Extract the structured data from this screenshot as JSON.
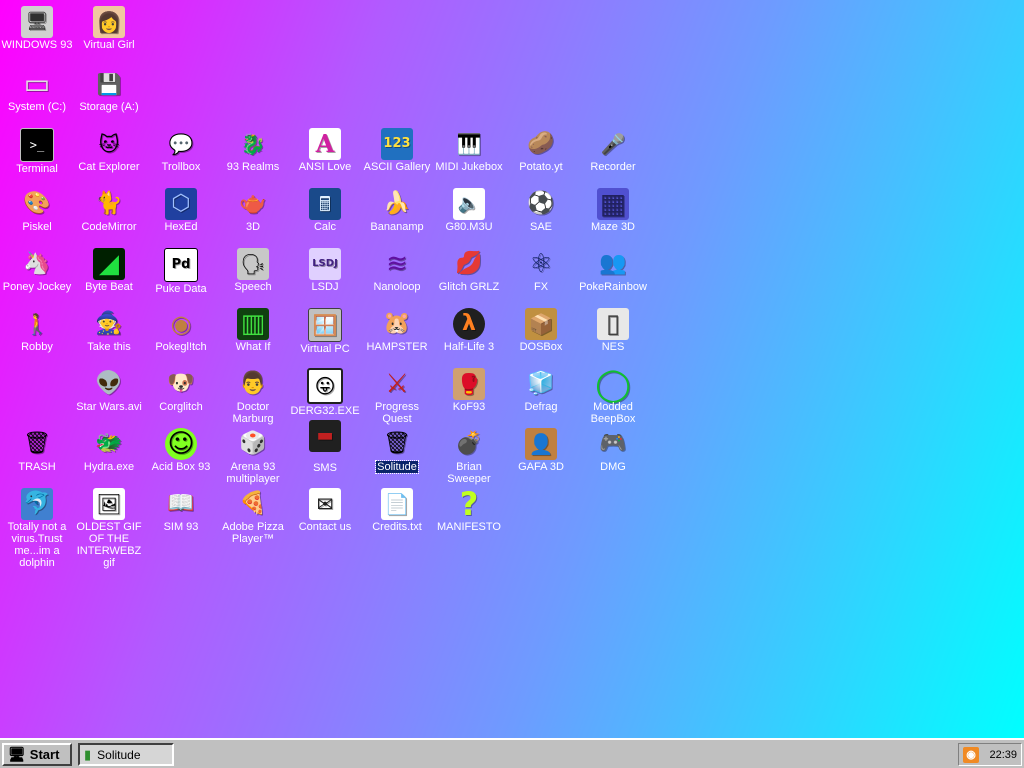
{
  "desktop": {
    "icons": [
      {
        "label": "WINDOWS 93",
        "glyph": "🖥",
        "color": "#d0d0d0"
      },
      {
        "label": "Virtual Girl",
        "glyph": "👩",
        "color": "#f0c8a0"
      },
      {
        "label": "System (C:)",
        "glyph": "▭",
        "color": "#c8c8c8"
      },
      {
        "label": "Storage (A:)",
        "glyph": "💾",
        "color": "#c8c8c8"
      },
      {
        "label": "Terminal",
        "glyph": ">_",
        "color": "#000000"
      },
      {
        "label": "Cat Explorer",
        "glyph": "🐱",
        "color": "#6fb0ff"
      },
      {
        "label": "Trollbox",
        "glyph": "💬",
        "color": "#ffe13a"
      },
      {
        "label": "93 Realms",
        "glyph": "🐉",
        "color": "#ff4040"
      },
      {
        "label": "ANSI Love",
        "glyph": "A",
        "color": "#ff40c0"
      },
      {
        "label": "ASCII Gallery",
        "glyph": "123",
        "color": "#40c8ff"
      },
      {
        "label": "MIDI Jukebox",
        "glyph": "🎹",
        "color": "#ffffff"
      },
      {
        "label": "Potato.yt",
        "glyph": "🥔",
        "color": "#c89040"
      },
      {
        "label": "Recorder",
        "glyph": "🎤",
        "color": "#c0c0c0"
      },
      {
        "label": "Piskel",
        "glyph": "🎨",
        "color": "#f0c050"
      },
      {
        "label": "CodeMirror",
        "glyph": "🐈",
        "color": "#ffffff"
      },
      {
        "label": "HexEd",
        "glyph": "⬡",
        "color": "#2040a0"
      },
      {
        "label": "3D",
        "glyph": "🫖",
        "color": "#e08060"
      },
      {
        "label": "Calc",
        "glyph": "🖩",
        "color": "#2060a0"
      },
      {
        "label": "Bananamp",
        "glyph": "🍌",
        "color": "#ffe030"
      },
      {
        "label": "G80.M3U",
        "glyph": "🔈",
        "color": "#ffffff"
      },
      {
        "label": "SAE",
        "glyph": "⚽",
        "color": "#ff3030"
      },
      {
        "label": "Maze 3D",
        "glyph": "▦",
        "color": "#4040c0"
      },
      {
        "label": "Poney Jockey",
        "glyph": "🦄",
        "color": "#c080ff"
      },
      {
        "label": "Byte Beat",
        "glyph": "◢",
        "color": "#20a020"
      },
      {
        "label": "Puke Data",
        "glyph": "Pd",
        "color": "#ffffff"
      },
      {
        "label": "Speech",
        "glyph": "🗣",
        "color": "#c0c0c0"
      },
      {
        "label": "LSDJ",
        "glyph": "LSDJ",
        "color": "#8040c0"
      },
      {
        "label": "Nanoloop",
        "glyph": "≋",
        "color": "#8020a0"
      },
      {
        "label": "Glitch GRLZ",
        "glyph": "💋",
        "color": "#ff2040"
      },
      {
        "label": "FX",
        "glyph": "⚛",
        "color": "#40a0ff"
      },
      {
        "label": "PokeRainbow",
        "glyph": "👥",
        "color": "#40a040"
      },
      {
        "label": "Robby",
        "glyph": "🚶",
        "color": "#ffffff"
      },
      {
        "label": "Take this",
        "glyph": "🧙",
        "color": "#ff6020"
      },
      {
        "label": "Pokegl!tch",
        "glyph": "◉",
        "color": "#c08040"
      },
      {
        "label": "What If",
        "glyph": "▥",
        "color": "#40a040"
      },
      {
        "label": "Virtual PC",
        "glyph": "🪟",
        "color": "#40a0ff"
      },
      {
        "label": "HAMPSTER",
        "glyph": "🐹",
        "color": "#ffffff"
      },
      {
        "label": "Half-Life 3",
        "glyph": "λ",
        "color": "#ff8020"
      },
      {
        "label": "DOSBox",
        "glyph": "📦",
        "color": "#c09040"
      },
      {
        "label": "NES",
        "glyph": "▯",
        "color": "#e0e0e0"
      },
      {
        "label": "Star Wars.avi",
        "glyph": "👽",
        "color": "#40c040"
      },
      {
        "label": "Corglitch",
        "glyph": "🐶",
        "color": "#f0a040"
      },
      {
        "label": "Doctor Marburg",
        "glyph": "👨",
        "color": "#ff8080"
      },
      {
        "label": "DERG32.EXE",
        "glyph": "😛",
        "color": "#ffffff"
      },
      {
        "label": "Progress Quest",
        "glyph": "⚔",
        "color": "#c02020"
      },
      {
        "label": "KoF93",
        "glyph": "🥊",
        "color": "#c08040"
      },
      {
        "label": "Defrag",
        "glyph": "🧊",
        "color": "#40c0ff"
      },
      {
        "label": "Modded BeepBox",
        "glyph": "◯",
        "color": "#20c040"
      },
      {
        "label": "TRASH",
        "glyph": "🗑",
        "color": "#c0c0c0"
      },
      {
        "label": "Hydra.exe",
        "glyph": "🐲",
        "color": "#40a040"
      },
      {
        "label": "Acid Box 93",
        "glyph": "☺",
        "color": "#80ff20"
      },
      {
        "label": "Arena 93 multiplayer",
        "glyph": "🎲",
        "color": "#40a0ff"
      },
      {
        "label": "SMS",
        "glyph": "▬",
        "color": "#202020"
      },
      {
        "label": "Solitude",
        "glyph": "🗑",
        "color": "#60a0ff"
      },
      {
        "label": "Brian Sweeper",
        "glyph": "💣",
        "color": "#202020"
      },
      {
        "label": "GAFA 3D",
        "glyph": "👤",
        "color": "#c08040"
      },
      {
        "label": "DMG",
        "glyph": "🎮",
        "color": "#c0c0c0"
      },
      {
        "label": "Totally not a virus.Trust me...im a dolphin",
        "glyph": "🐬",
        "color": "#40a0ff"
      },
      {
        "label": "OLDEST GIF OF THE INTERWEBZ gif",
        "glyph": "🖼",
        "color": "#ff4040"
      },
      {
        "label": "SIM 93",
        "glyph": "📖",
        "color": "#c0c0ff"
      },
      {
        "label": "Adobe Pizza Player™",
        "glyph": "🍕",
        "color": "#ff6040"
      },
      {
        "label": "Contact us",
        "glyph": "✉",
        "color": "#ffffff"
      },
      {
        "label": "Credits.txt",
        "glyph": "📄",
        "color": "#ffffff"
      },
      {
        "label": "MANIFESTO",
        "glyph": "?",
        "color": "#c0ff20"
      }
    ]
  },
  "taskbar": {
    "start_label": "Start",
    "tasks": [
      {
        "label": "Solitude"
      }
    ],
    "clock": "22:39"
  }
}
